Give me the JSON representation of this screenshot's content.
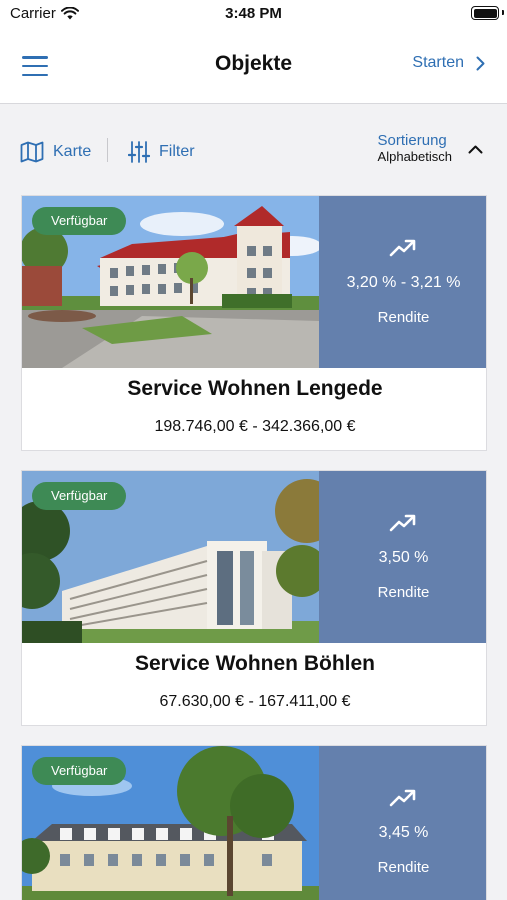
{
  "status_bar": {
    "carrier": "Carrier",
    "time": "3:48 PM",
    "icons": [
      "wifi-icon",
      "battery-icon"
    ]
  },
  "nav": {
    "title": "Objekte",
    "start_label": "Starten",
    "icons": [
      "menu-icon",
      "chevron-right-icon"
    ]
  },
  "toolbar": {
    "map_label": "Karte",
    "filter_label": "Filter",
    "sort_label": "Sortierung",
    "sort_value": "Alphabetisch",
    "icons": [
      "map-icon",
      "sliders-icon",
      "chevron-up-icon"
    ]
  },
  "listings": [
    {
      "status": "Verfügbar",
      "yield": "3,20 % - 3,21 %",
      "yield_label": "Rendite",
      "name": "Service Wohnen Lengede",
      "price": "198.746,00 € - 342.366,00 €"
    },
    {
      "status": "Verfügbar",
      "yield": "3,50 %",
      "yield_label": "Rendite",
      "name": "Service Wohnen Böhlen",
      "price": "67.630,00 € - 167.411,00 €"
    },
    {
      "status": "Verfügbar",
      "yield": "3,45 %",
      "yield_label": "Rendite"
    }
  ],
  "colors": {
    "accent": "#2f6fb3",
    "badge": "#3e8a55",
    "yield_panel": "#6480ad",
    "background": "#f2f2f4"
  }
}
